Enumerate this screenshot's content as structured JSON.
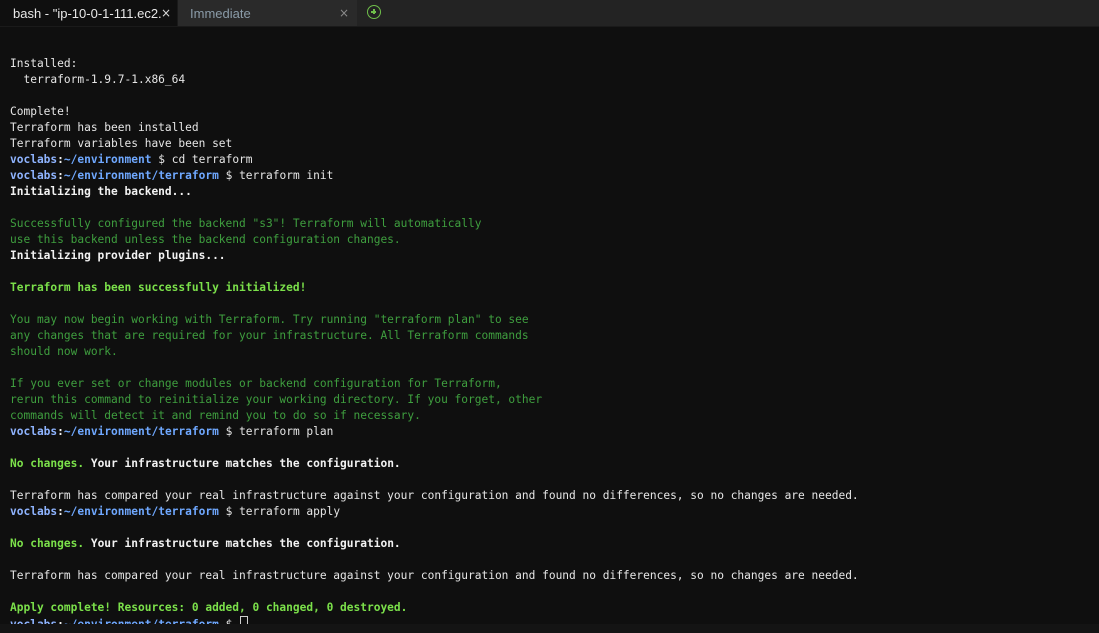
{
  "tabs": [
    {
      "label": "bash - \"ip-10-0-1-111.ec2.",
      "close": "×",
      "active": true
    },
    {
      "label": "Immediate",
      "close": "×",
      "active": false
    }
  ],
  "add_tab_icon": "plus-circle-icon",
  "prompt": {
    "user": "voclabs",
    "path_home": "~/environment",
    "path_tf": "~/environment/terraform",
    "symbol": "$"
  },
  "terminal": {
    "installed_label": "Installed:",
    "installed_pkg": "  terraform-1.9.7-1.x86_64",
    "complete": "Complete!",
    "tf_installed": "Terraform has been installed",
    "tf_vars_set": "Terraform variables have been set",
    "cmd_cd": " cd terraform",
    "cmd_init": " terraform init",
    "init_backend": "Initializing the backend...",
    "backend_msg_1": "Successfully configured the backend \"s3\"! Terraform will automatically",
    "backend_msg_2": "use this backend unless the backend configuration changes.",
    "init_plugins": "Initializing provider plugins...",
    "init_success": "Terraform has been successfully initialized!",
    "init_msg_1": "You may now begin working with Terraform. Try running \"terraform plan\" to see",
    "init_msg_2": "any changes that are required for your infrastructure. All Terraform commands",
    "init_msg_3": "should now work.",
    "init_msg_4": "If you ever set or change modules or backend configuration for Terraform,",
    "init_msg_5": "rerun this command to reinitialize your working directory. If you forget, other",
    "init_msg_6": "commands will detect it and remind you to do so if necessary.",
    "cmd_plan": " terraform plan",
    "no_changes": "No changes.",
    "matches": " Your infrastructure matches the configuration.",
    "compared": "Terraform has compared your real infrastructure against your configuration and found no differences, so no changes are needed.",
    "cmd_apply": " terraform apply",
    "apply_complete": "Apply complete! Resources: 0 added, 0 changed, 0 destroyed."
  },
  "colors": {
    "background": "#0f0f0f",
    "green_dim": "#3f9f3f",
    "green_bright": "#7be04a",
    "prompt_blue": "#8fb4ff"
  }
}
